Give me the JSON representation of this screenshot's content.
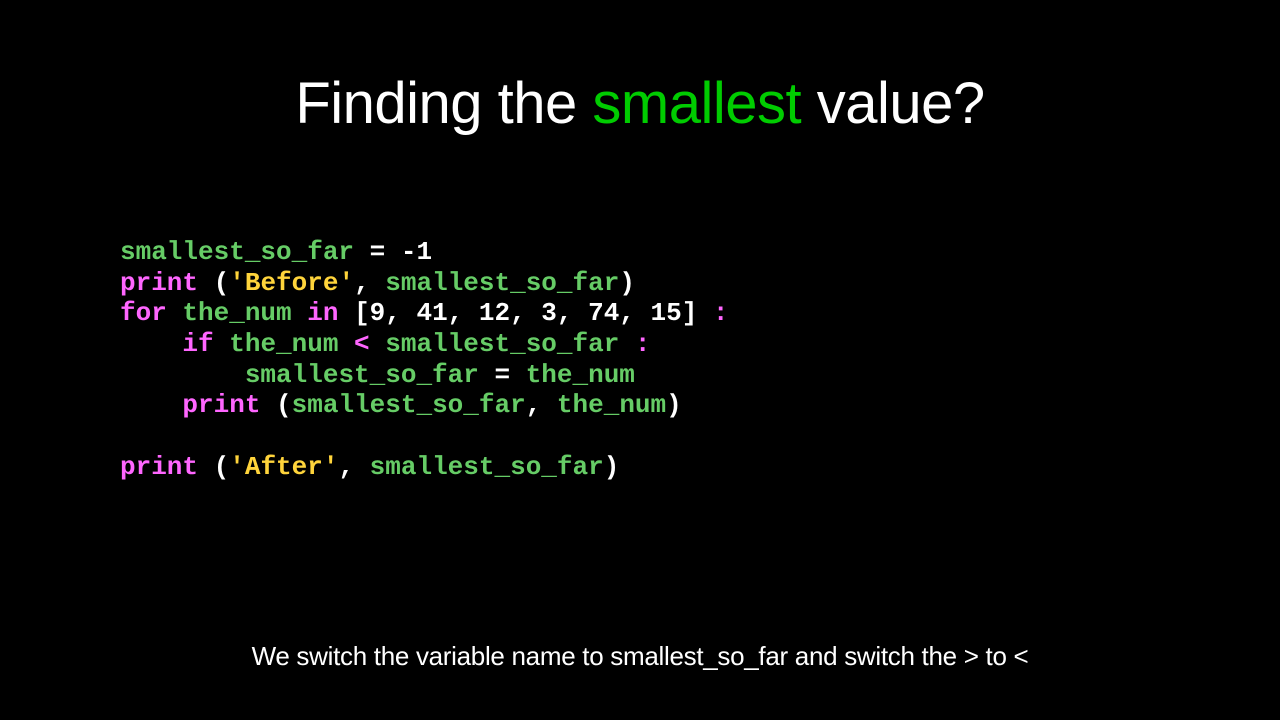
{
  "title": {
    "pre": "Finding the ",
    "highlight": "smallest",
    "post": " value?"
  },
  "code": {
    "line1_var": "smallest_so_far",
    "line1_rest": " = -1",
    "line2_print": "print",
    "line2_open": " (",
    "line2_str": "'Before'",
    "line2_comma": ", ",
    "line2_arg": "smallest_so_far",
    "line2_close": ")",
    "line3_for": "for ",
    "line3_var": "the_num",
    "line3_in": " in ",
    "line3_list": "[9, 41, 12, 3, 74, 15]",
    "line3_colon": " :",
    "line4_indent": "    ",
    "line4_if": "if ",
    "line4_lhs": "the_num",
    "line4_op": " < ",
    "line4_rhs": "smallest_so_far",
    "line4_colon": " :",
    "line5_indent": "        ",
    "line5_lhs": "smallest_so_far",
    "line5_eq": " = ",
    "line5_rhs": "the_num",
    "line6_indent": "    ",
    "line6_print": "print",
    "line6_open": " (",
    "line6_arg1": "smallest_so_far",
    "line6_comma": ", ",
    "line6_arg2": "the_num",
    "line6_close": ")",
    "line7_print": "print",
    "line7_open": " (",
    "line7_str": "'After'",
    "line7_comma": ", ",
    "line7_arg": "smallest_so_far",
    "line7_close": ")"
  },
  "footer": "We switch the variable name to smallest_so_far and switch the > to <"
}
